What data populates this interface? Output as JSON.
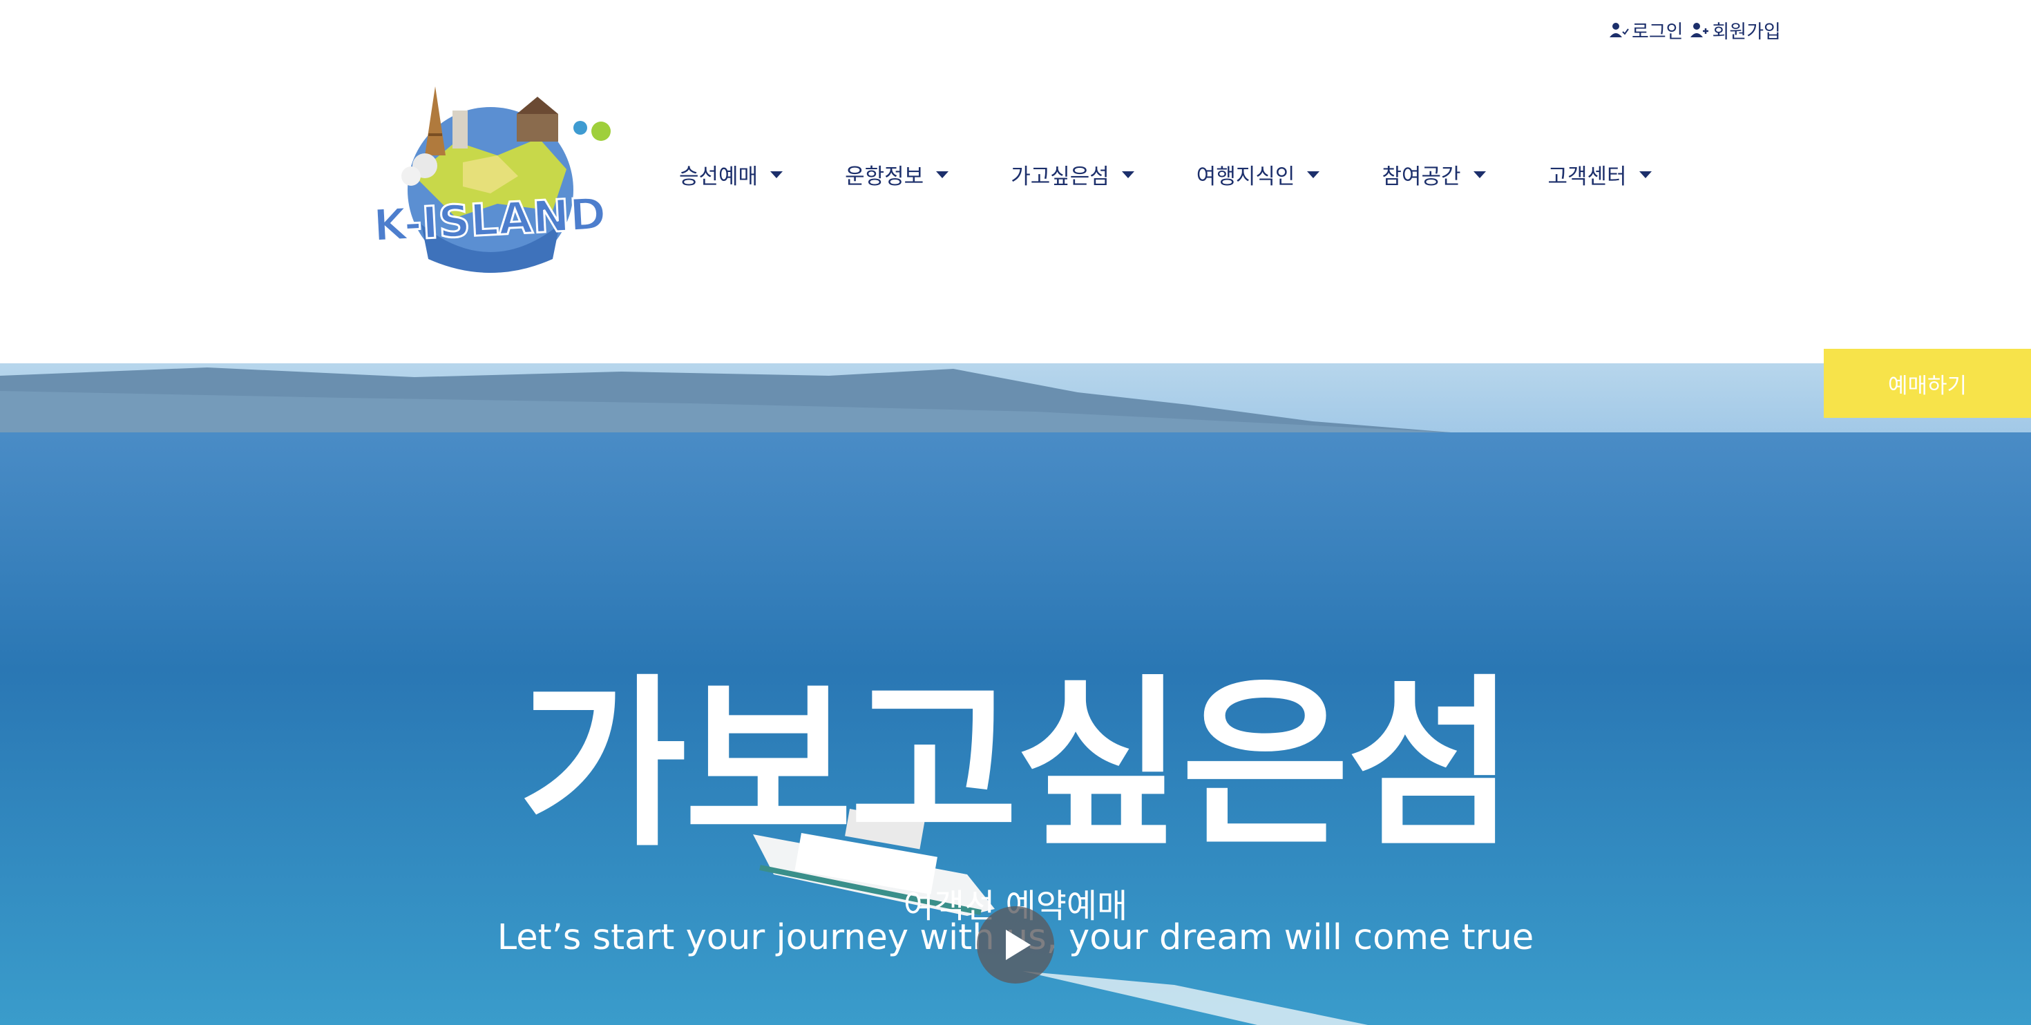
{
  "utility": {
    "login_label": "로그인",
    "signup_label": "회원가입"
  },
  "logo": {
    "text": "K-ISLAND"
  },
  "nav": {
    "items": [
      {
        "label": "승선예매"
      },
      {
        "label": "운항정보"
      },
      {
        "label": "가고싶은섬"
      },
      {
        "label": "여행지식인"
      },
      {
        "label": "참여공간"
      },
      {
        "label": "고객센터"
      }
    ]
  },
  "hero": {
    "title": "가보고싶은섬",
    "subtitle": "여객선 예약예매",
    "tagline": "Let’s start your journey with us, your dream will come true",
    "book_button": "예매하기"
  },
  "colors": {
    "nav_text": "#1c2f6b",
    "book_button_bg": "#f7e34a",
    "sea": "#2b7ab6"
  },
  "icons": [
    "user-check-icon",
    "user-plus-icon",
    "caret-down-icon",
    "play-icon"
  ]
}
